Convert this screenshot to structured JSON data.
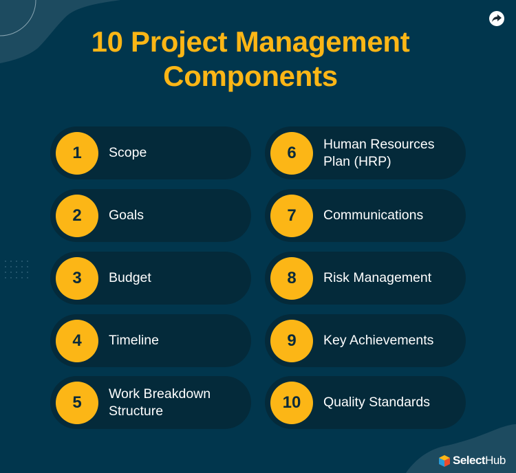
{
  "title": {
    "line1": "10 Project Management",
    "line2": "Components"
  },
  "share_icon": "share-arrow-icon",
  "components": [
    {
      "number": "1",
      "label_lines": [
        "Scope"
      ]
    },
    {
      "number": "2",
      "label_lines": [
        "Goals"
      ]
    },
    {
      "number": "3",
      "label_lines": [
        "Budget"
      ]
    },
    {
      "number": "4",
      "label_lines": [
        "Timeline"
      ]
    },
    {
      "number": "5",
      "label_lines": [
        "Work Breakdown",
        "Structure"
      ]
    },
    {
      "number": "6",
      "label_lines": [
        "Human Resources",
        "Plan (HRP)"
      ]
    },
    {
      "number": "7",
      "label_lines": [
        "Communications"
      ]
    },
    {
      "number": "8",
      "label_lines": [
        "Risk Management"
      ]
    },
    {
      "number": "9",
      "label_lines": [
        "Key Achievements"
      ]
    },
    {
      "number": "10",
      "label_lines": [
        "Quality Standards"
      ]
    }
  ],
  "logo": {
    "brand_bold": "Select",
    "brand_regular": "Hub"
  },
  "colors": {
    "background": "#01364d",
    "accent": "#fcb616",
    "pill": "#042a3a",
    "text": "#ffffff"
  }
}
